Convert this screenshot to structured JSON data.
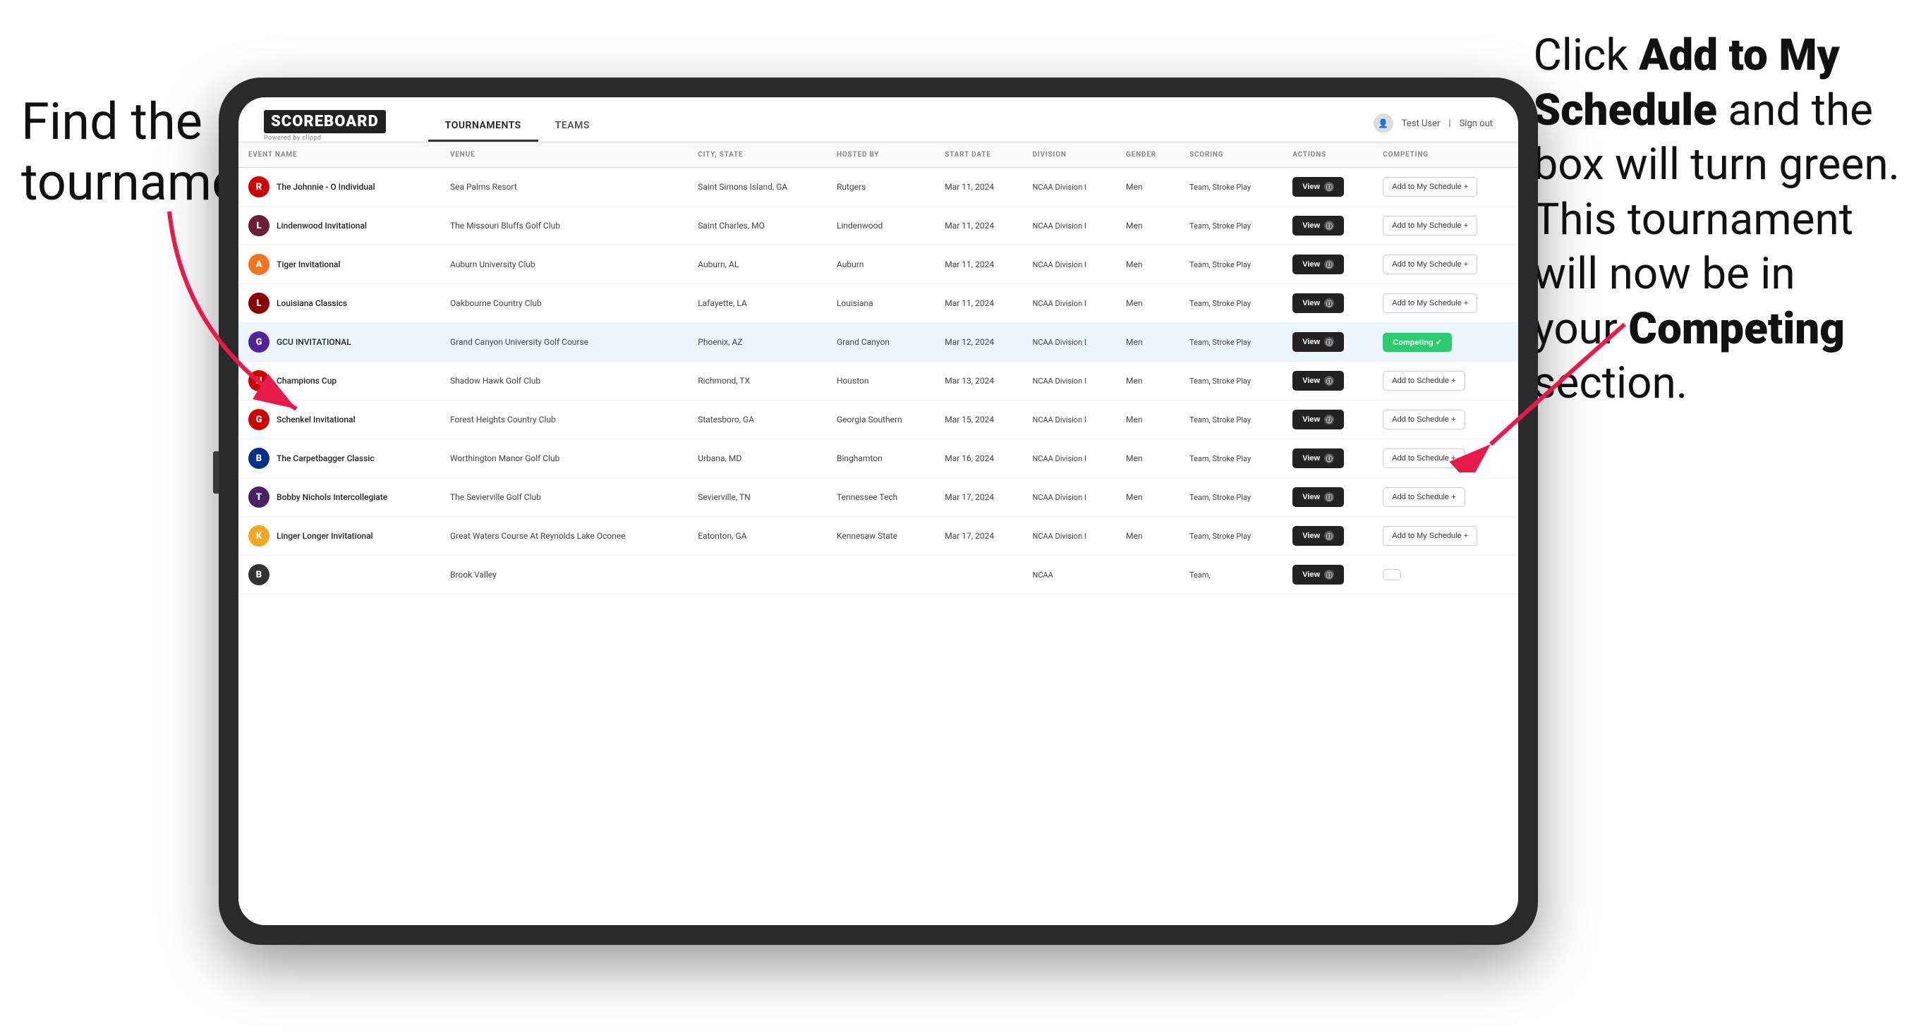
{
  "instructions": {
    "left": "Find the\ntournament.",
    "right_part1": "Click ",
    "right_bold1": "Add to My\nSchedule",
    "right_part2": " and the\nbox will turn green.\nThis tournament\nwill now be in\nyour ",
    "right_bold2": "Competing",
    "right_part3": "\nsection."
  },
  "app": {
    "logo": "SCOREBOARD",
    "logo_sub": "Powered by clippd",
    "nav_tabs": [
      "TOURNAMENTS",
      "TEAMS"
    ],
    "active_tab": "TOURNAMENTS",
    "user": "Test User",
    "sign_out": "Sign out"
  },
  "table": {
    "columns": [
      "EVENT NAME",
      "VENUE",
      "CITY, STATE",
      "HOSTED BY",
      "START DATE",
      "DIVISION",
      "GENDER",
      "SCORING",
      "ACTIONS",
      "COMPETING"
    ],
    "rows": [
      {
        "logo_letter": "R",
        "logo_color": "#cc0000",
        "event": "The Johnnie - O Individual",
        "venue": "Sea Palms Resort",
        "city": "Saint Simons Island, GA",
        "hosted": "Rutgers",
        "date": "Mar 11, 2024",
        "division": "NCAA Division I",
        "gender": "Men",
        "scoring": "Team, Stroke Play",
        "action": "View",
        "competing_label": "Add to My Schedule +",
        "is_competing": false
      },
      {
        "logo_letter": "L",
        "logo_color": "#6d1e36",
        "event": "Lindenwood Invitational",
        "venue": "The Missouri Bluffs Golf Club",
        "city": "Saint Charles, MO",
        "hosted": "Lindenwood",
        "date": "Mar 11, 2024",
        "division": "NCAA Division I",
        "gender": "Men",
        "scoring": "Team, Stroke Play",
        "action": "View",
        "competing_label": "Add to My Schedule +",
        "is_competing": false
      },
      {
        "logo_letter": "A",
        "logo_color": "#f47321",
        "event": "Tiger Invitational",
        "venue": "Auburn University Club",
        "city": "Auburn, AL",
        "hosted": "Auburn",
        "date": "Mar 11, 2024",
        "division": "NCAA Division I",
        "gender": "Men",
        "scoring": "Team, Stroke Play",
        "action": "View",
        "competing_label": "Add to My Schedule +",
        "is_competing": false
      },
      {
        "logo_letter": "L",
        "logo_color": "#8b0000",
        "event": "Louisiana Classics",
        "venue": "Oakbourne Country Club",
        "city": "Lafayette, LA",
        "hosted": "Louisiana",
        "date": "Mar 11, 2024",
        "division": "NCAA Division I",
        "gender": "Men",
        "scoring": "Team, Stroke Play",
        "action": "View",
        "competing_label": "Add to My Schedule +",
        "is_competing": false
      },
      {
        "logo_letter": "G",
        "logo_color": "#522398",
        "event": "GCU INVITATIONAL",
        "venue": "Grand Canyon University Golf Course",
        "city": "Phoenix, AZ",
        "hosted": "Grand Canyon",
        "date": "Mar 12, 2024",
        "division": "NCAA Division I",
        "gender": "Men",
        "scoring": "Team, Stroke Play",
        "action": "View",
        "competing_label": "Competing ✓",
        "is_competing": true
      },
      {
        "logo_letter": "H",
        "logo_color": "#cc0000",
        "event": "Champions Cup",
        "venue": "Shadow Hawk Golf Club",
        "city": "Richmond, TX",
        "hosted": "Houston",
        "date": "Mar 13, 2024",
        "division": "NCAA Division I",
        "gender": "Men",
        "scoring": "Team, Stroke Play",
        "action": "View",
        "competing_label": "Add to Schedule +",
        "is_competing": false
      },
      {
        "logo_letter": "G",
        "logo_color": "#cc0000",
        "event": "Schenkel Invitational",
        "venue": "Forest Heights Country Club",
        "city": "Statesboro, GA",
        "hosted": "Georgia Southern",
        "date": "Mar 15, 2024",
        "division": "NCAA Division I",
        "gender": "Men",
        "scoring": "Team, Stroke Play",
        "action": "View",
        "competing_label": "Add to Schedule +",
        "is_competing": false
      },
      {
        "logo_letter": "B",
        "logo_color": "#003087",
        "event": "The Carpetbagger Classic",
        "venue": "Worthington Manor Golf Club",
        "city": "Urbana, MD",
        "hosted": "Binghamton",
        "date": "Mar 16, 2024",
        "division": "NCAA Division I",
        "gender": "Men",
        "scoring": "Team, Stroke Play",
        "action": "View",
        "competing_label": "Add to Schedule +",
        "is_competing": false
      },
      {
        "logo_letter": "T",
        "logo_color": "#4b2167",
        "event": "Bobby Nichols Intercollegiate",
        "venue": "The Sevierville Golf Club",
        "city": "Sevierville, TN",
        "hosted": "Tennessee Tech",
        "date": "Mar 17, 2024",
        "division": "NCAA Division I",
        "gender": "Men",
        "scoring": "Team, Stroke Play",
        "action": "View",
        "competing_label": "Add to Schedule +",
        "is_competing": false
      },
      {
        "logo_letter": "K",
        "logo_color": "#f5a623",
        "event": "Linger Longer Invitational",
        "venue": "Great Waters Course At Reynolds Lake Oconee",
        "city": "Eatonton, GA",
        "hosted": "Kennesaw State",
        "date": "Mar 17, 2024",
        "division": "NCAA Division I",
        "gender": "Men",
        "scoring": "Team, Stroke Play",
        "action": "View",
        "competing_label": "Add to My Schedule +",
        "is_competing": false
      },
      {
        "logo_letter": "B",
        "logo_color": "#333",
        "event": "",
        "venue": "Brook Valley",
        "city": "",
        "hosted": "",
        "date": "",
        "division": "NCAA",
        "gender": "",
        "scoring": "Team,",
        "action": "View",
        "competing_label": "",
        "is_competing": false
      }
    ]
  }
}
